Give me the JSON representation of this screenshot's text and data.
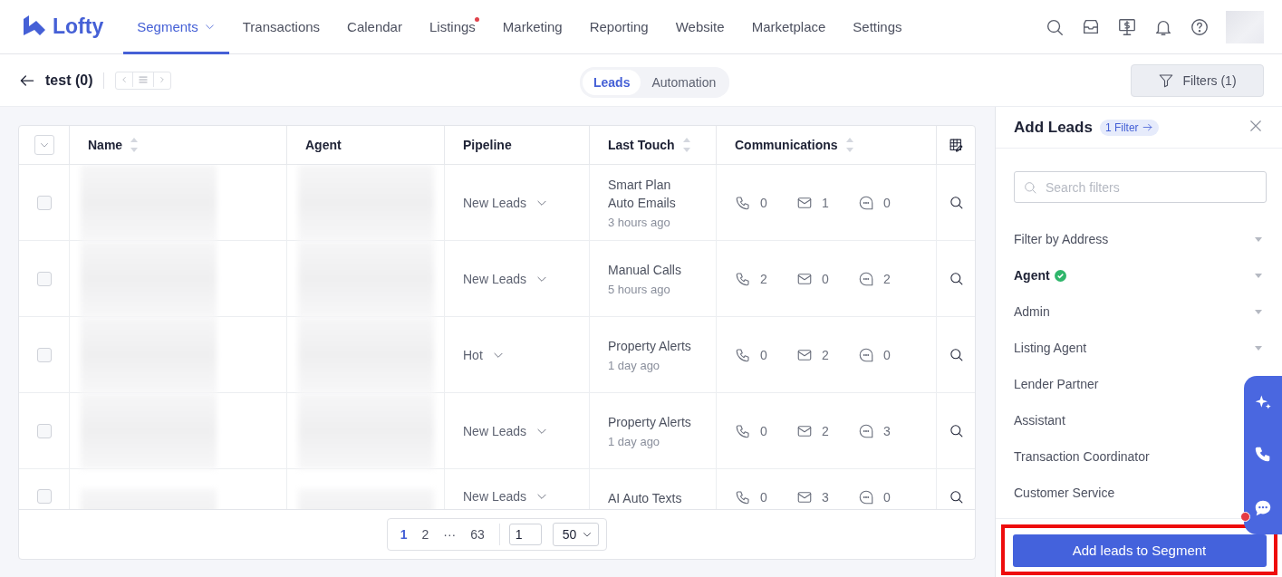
{
  "nav": {
    "logo": "Lofty",
    "items": [
      {
        "label": "Segments",
        "selected": true,
        "dropdown": true,
        "dot": false
      },
      {
        "label": "Transactions",
        "selected": false,
        "dropdown": false,
        "dot": false
      },
      {
        "label": "Calendar",
        "selected": false,
        "dropdown": false,
        "dot": false
      },
      {
        "label": "Listings",
        "selected": false,
        "dropdown": false,
        "dot": true
      },
      {
        "label": "Marketing",
        "selected": false,
        "dropdown": false,
        "dot": false
      },
      {
        "label": "Reporting",
        "selected": false,
        "dropdown": false,
        "dot": false
      },
      {
        "label": "Website",
        "selected": false,
        "dropdown": false,
        "dot": false
      },
      {
        "label": "Marketplace",
        "selected": false,
        "dropdown": false,
        "dot": false
      },
      {
        "label": "Settings",
        "selected": false,
        "dropdown": false,
        "dot": false
      }
    ]
  },
  "header": {
    "title": "test (0)",
    "view_tabs": [
      {
        "label": "Leads",
        "selected": true
      },
      {
        "label": "Automation",
        "selected": false
      }
    ],
    "filters_button": "Filters (1)"
  },
  "table": {
    "select_all_checked": false,
    "columns": [
      {
        "label": "Name",
        "sortable": true
      },
      {
        "label": "Agent",
        "sortable": false
      },
      {
        "label": "Pipeline",
        "sortable": false
      },
      {
        "label": "Last Touch",
        "sortable": true
      },
      {
        "label": "Communications",
        "sortable": true
      }
    ],
    "rows": [
      {
        "checked": false,
        "pipeline": "New Leads",
        "last_touch": "Smart Plan Auto Emails",
        "last_touch_time": "3 hours ago",
        "calls": "0",
        "emails": "1",
        "texts": "0"
      },
      {
        "checked": false,
        "pipeline": "New Leads",
        "last_touch": "Manual Calls",
        "last_touch_time": "5 hours ago",
        "calls": "2",
        "emails": "0",
        "texts": "2"
      },
      {
        "checked": false,
        "pipeline": "Hot",
        "last_touch": "Property Alerts",
        "last_touch_time": "1 day ago",
        "calls": "0",
        "emails": "2",
        "texts": "0"
      },
      {
        "checked": false,
        "pipeline": "New Leads",
        "last_touch": "Property Alerts",
        "last_touch_time": "1 day ago",
        "calls": "0",
        "emails": "2",
        "texts": "3"
      },
      {
        "checked": false,
        "pipeline": "New Leads",
        "last_touch": "AI Auto Texts",
        "calls": "0",
        "emails": "3",
        "texts": "0"
      }
    ],
    "pagination": {
      "pages": [
        {
          "label": "1",
          "selected": true
        },
        {
          "label": "2",
          "selected": false
        },
        {
          "label": "···",
          "selected": false
        },
        {
          "label": "63",
          "selected": false
        }
      ],
      "jump_value": "1",
      "page_size": "50"
    }
  },
  "panel": {
    "title": "Add Leads",
    "filter_badge": "1 Filter",
    "search_placeholder": "Search filters",
    "filters": [
      {
        "label": "Filter by Address",
        "active": false,
        "expandable": true
      },
      {
        "label": "Agent",
        "active": true,
        "expandable": true
      },
      {
        "label": "Admin",
        "active": false,
        "expandable": true
      },
      {
        "label": "Listing Agent",
        "active": false,
        "expandable": true
      },
      {
        "label": "Lender Partner",
        "active": false
      },
      {
        "label": "Assistant",
        "active": false
      },
      {
        "label": "Transaction Coordinator",
        "active": false
      },
      {
        "label": "Customer Service",
        "active": false
      }
    ],
    "submit": "Add leads to Segment"
  }
}
